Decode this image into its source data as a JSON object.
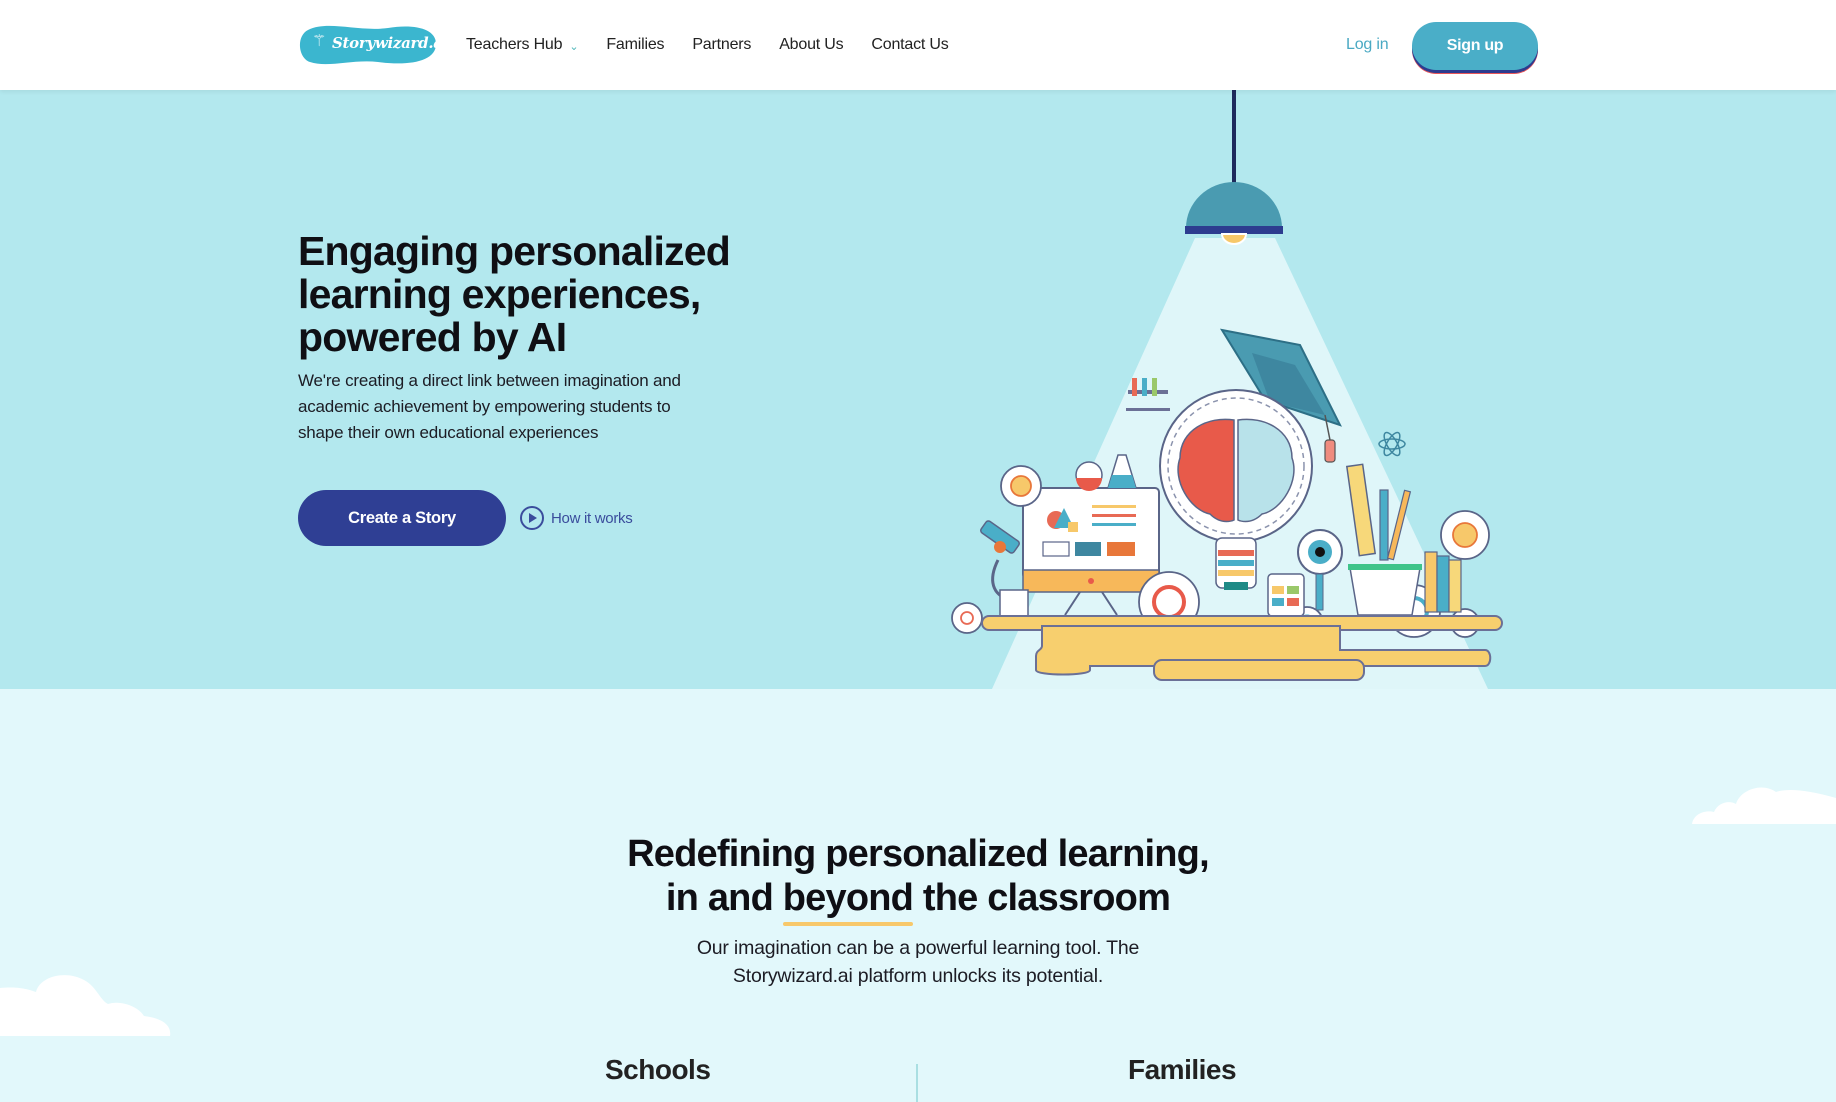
{
  "nav": {
    "logo_text": "Storywizard.ai",
    "links": [
      {
        "label": "Teachers Hub",
        "has_dropdown": true
      },
      {
        "label": "Families"
      },
      {
        "label": "Partners"
      },
      {
        "label": "About Us"
      },
      {
        "label": "Contact Us"
      }
    ],
    "login_label": "Log in",
    "signup_label": "Sign up"
  },
  "hero": {
    "title_lines": [
      "Engaging personalized",
      "learning experiences,",
      "powered by AI"
    ],
    "subtitle_lines": [
      "We're creating a direct link between imagination and",
      "academic achievement by empowering students to",
      "shape their own educational experiences"
    ],
    "cta_label": "Create a Story",
    "how_label": "How it works",
    "illustration": "lamp-lightbulb-brain-education-icon"
  },
  "section2": {
    "title_line1": "Redefining personalized learning,",
    "title_line2_pre": "in and ",
    "title_line2_highlight": "beyond",
    "title_line2_post": " the classroom",
    "subtitle_line1": "Our imagination can be a powerful learning tool. The",
    "subtitle_line2": "Storywizard.ai platform unlocks its potential.",
    "columns": [
      "Schools",
      "Families"
    ]
  },
  "colors": {
    "brand": "#4aaec8",
    "cta": "#2f3f94",
    "hero_bg": "#b3e8ee",
    "page_bg": "#e2f8fb",
    "highlight": "#f7c86a"
  }
}
